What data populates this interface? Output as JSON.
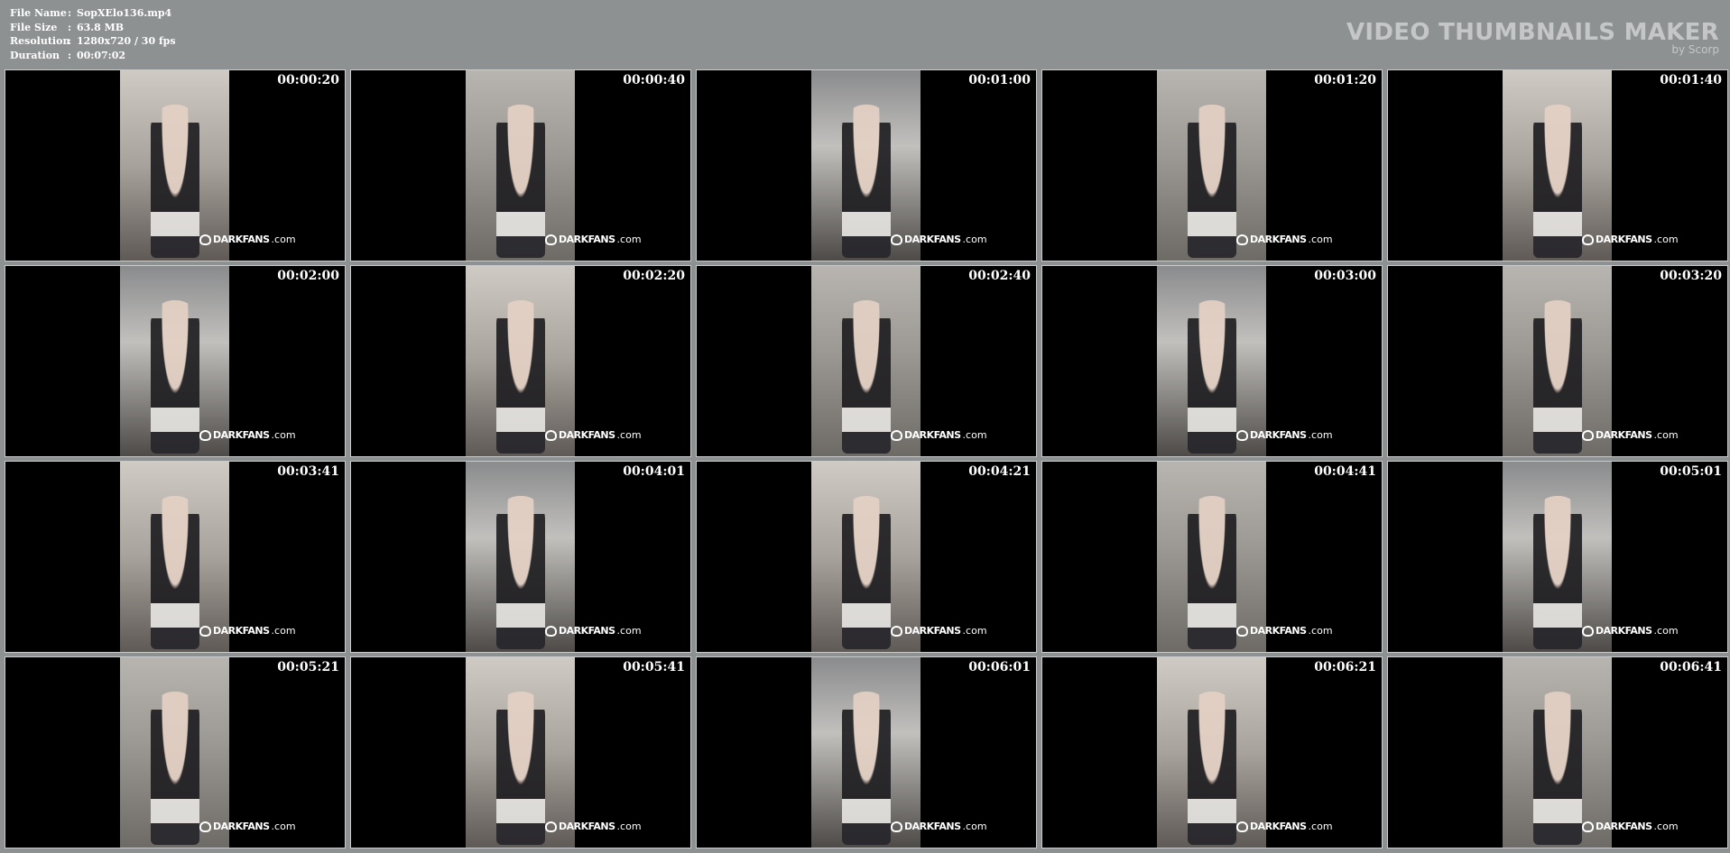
{
  "info": {
    "rows": [
      {
        "key": "File Name",
        "sep": ":",
        "value": "SopXElo136.mp4"
      },
      {
        "key": "File Size",
        "sep": ":",
        "value": "63.8 MB"
      },
      {
        "key": "Resolution",
        "sep": ":",
        "value": "1280x720 / 30 fps"
      },
      {
        "key": "Duration",
        "sep": ":",
        "value": "00:07:02"
      }
    ]
  },
  "brand": {
    "title": "VIDEO THUMBNAILS MAKER",
    "subtitle": "by Scorp"
  },
  "watermark": {
    "strong": "DARKFANS",
    "suffix": ".com",
    "icon": "darkfans-logo-icon"
  },
  "thumbnails": [
    {
      "timestamp": "00:00:20"
    },
    {
      "timestamp": "00:00:40"
    },
    {
      "timestamp": "00:01:00"
    },
    {
      "timestamp": "00:01:20"
    },
    {
      "timestamp": "00:01:40"
    },
    {
      "timestamp": "00:02:00"
    },
    {
      "timestamp": "00:02:20"
    },
    {
      "timestamp": "00:02:40"
    },
    {
      "timestamp": "00:03:00"
    },
    {
      "timestamp": "00:03:20"
    },
    {
      "timestamp": "00:03:41"
    },
    {
      "timestamp": "00:04:01"
    },
    {
      "timestamp": "00:04:21"
    },
    {
      "timestamp": "00:04:41"
    },
    {
      "timestamp": "00:05:01"
    },
    {
      "timestamp": "00:05:21"
    },
    {
      "timestamp": "00:05:41"
    },
    {
      "timestamp": "00:06:01"
    },
    {
      "timestamp": "00:06:21"
    },
    {
      "timestamp": "00:06:41"
    }
  ],
  "colors": {
    "background": "#8e9192",
    "thumb_border": "#c9cbcc",
    "brand_text": "#c4c6c7"
  }
}
